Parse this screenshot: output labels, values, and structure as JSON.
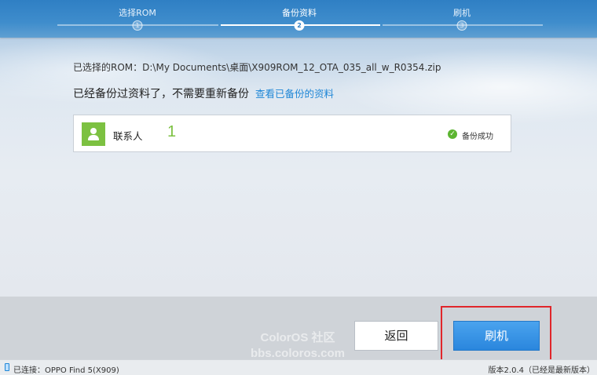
{
  "steps": {
    "items": [
      {
        "label": "选择ROM",
        "num": "1"
      },
      {
        "label": "备份资料",
        "num": "2"
      },
      {
        "label": "刷机",
        "num": "3"
      }
    ],
    "active_index": 1
  },
  "rom": {
    "path_text": "已选择的ROM：D:\\My Documents\\桌面\\X909ROM_12_OTA_035_all_w_R0354.zip"
  },
  "backup": {
    "message": "已经备份过资料了，不需要重新备份",
    "link_label": "查看已备份的资料"
  },
  "contacts": {
    "name": "联系人",
    "count": "1",
    "status": "备份成功",
    "status_icon": "check-circle-icon"
  },
  "actions": {
    "back_label": "返回",
    "flash_label": "刷机"
  },
  "watermark": {
    "line1": "ColorOS 社区",
    "line2": "bbs.coloros.com"
  },
  "statusbar": {
    "connection": "已连接：OPPO Find 5(X909)",
    "version": "版本2.0.4（已经是最新版本）"
  },
  "colors": {
    "accent": "#2a86dd",
    "success": "#7cc141",
    "highlight": "#e0262b"
  }
}
